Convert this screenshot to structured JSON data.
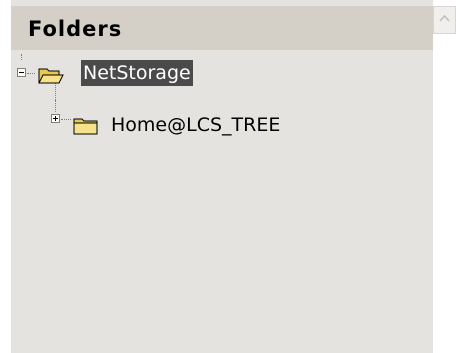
{
  "panel": {
    "title": "Folders"
  },
  "tree": {
    "nodes": [
      {
        "label": "NetStorage",
        "expander": "minus",
        "icon": "folder-open-icon",
        "selected": true
      },
      {
        "label": "Home@LCS_TREE",
        "expander": "plus",
        "icon": "folder-closed-icon",
        "selected": false
      }
    ]
  },
  "colors": {
    "pane_bg": "#e5e3df",
    "header_bg": "#d4d0c8",
    "selection_bg": "#4a4a4a",
    "folder_yellow": "#f5e28a"
  },
  "scrollbar": {
    "icon": "scroll-up-arrow-icon"
  }
}
